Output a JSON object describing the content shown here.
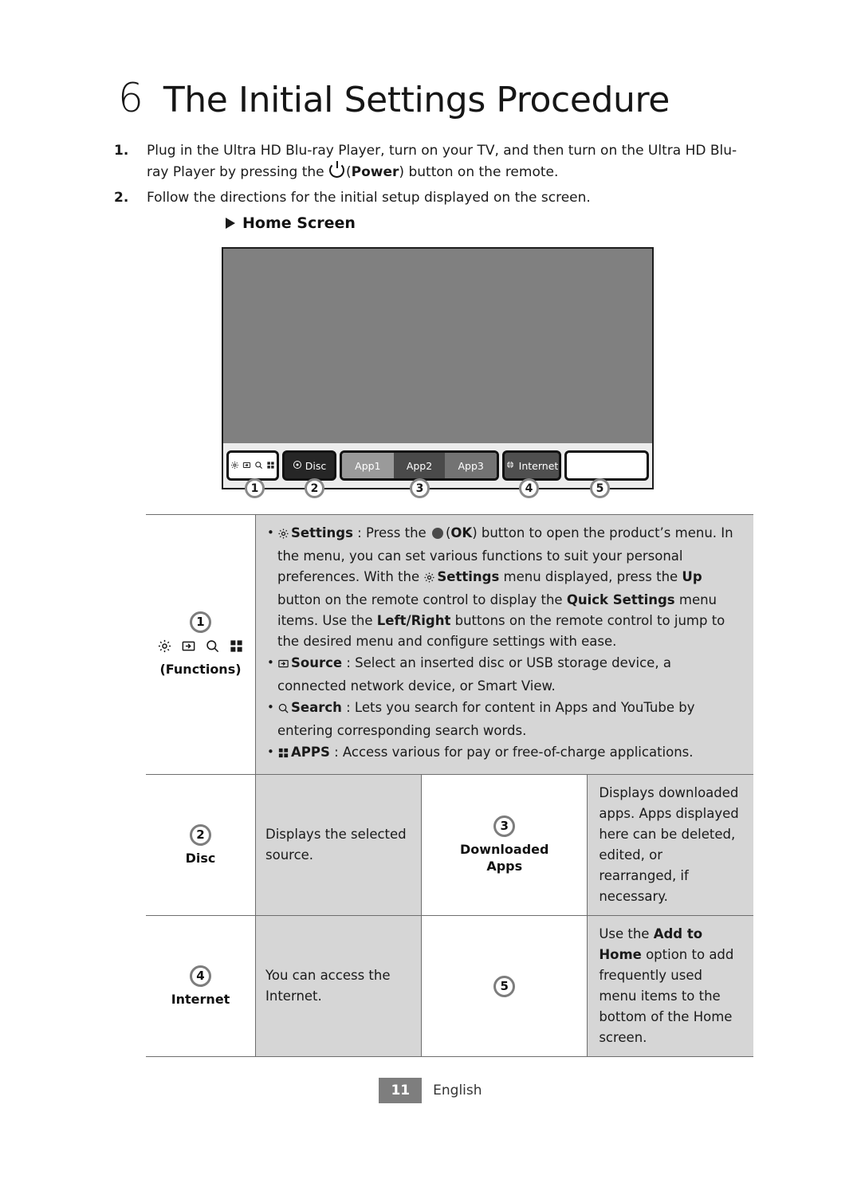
{
  "chapter": {
    "number": "6",
    "title": "The Initial Settings Procedure"
  },
  "steps": [
    {
      "num": "1.",
      "pre": "Plug in the Ultra HD Blu-ray Player, turn on your TV, and then turn on the Ultra HD Blu-ray Player by pressing the ",
      "icon": "power-icon",
      "bold": "Power",
      "post": ") button on the remote.",
      "open": "("
    },
    {
      "num": "2.",
      "text": "Follow the directions for the initial setup displayed on the screen."
    }
  ],
  "sub_heading": "Home Screen",
  "tv": {
    "functions_icons": [
      "gear-icon",
      "source-icon",
      "search-icon",
      "apps-icon"
    ],
    "disc_label": "Disc",
    "apps": [
      "App1",
      "App2",
      "App3"
    ],
    "internet_label": "Internet",
    "callouts": [
      "1",
      "2",
      "3",
      "4",
      "5"
    ]
  },
  "table": {
    "row1": {
      "badge": "1",
      "icons": [
        "gear-icon",
        "source-icon",
        "search-icon",
        "apps-icon"
      ],
      "caption": "(Functions)",
      "bullets": [
        {
          "icon": "gear-icon",
          "name": "Settings",
          "body_1": " : Press the ",
          "ok_open": "(",
          "ok": "OK",
          "body_2": ") button to open the product’s menu. In the menu, you can set various functions to suit your personal preferences. With the ",
          "name_2": "Settings",
          "body_3": " menu displayed, press the ",
          "up": "Up",
          "body_4": " button on the remote control to display the ",
          "quick": "Quick Settings",
          "body_5": " menu items. Use the ",
          "lr": "Left/Right",
          "body_6": " buttons on the remote control to jump to the desired menu and configure settings with ease."
        },
        {
          "icon": "source-icon",
          "name": "Source",
          "body": " : Select an inserted disc or USB storage device, a connected network device, or Smart View."
        },
        {
          "icon": "search-icon",
          "name": "Search",
          "body": " : Lets you search for content in Apps and YouTube by entering corresponding search words."
        },
        {
          "icon": "apps-icon",
          "name": "APPS",
          "body": " : Access various for pay or free-of-charge applications."
        }
      ]
    },
    "row2": {
      "left_badge": "2",
      "left_caption": "Disc",
      "left_desc": "Displays the selected source.",
      "mid_badge": "3",
      "mid_caption_line1": "Downloaded",
      "mid_caption_line2": "Apps",
      "right_desc": "Displays downloaded apps. Apps displayed here can be deleted, edited, or rearranged, if necessary."
    },
    "row3": {
      "left_badge": "4",
      "left_caption": "Internet",
      "left_desc": "You can access the Internet.",
      "mid_badge": "5",
      "right_pre": "Use the ",
      "right_bold": "Add to Home",
      "right_post": " option to add frequently used menu items to the bottom of the Home screen."
    }
  },
  "footer": {
    "page_number": "11",
    "language": "English"
  },
  "colors": {
    "screen_gray": "#808080",
    "strip_gray": "#ececec",
    "cell_gray": "#d6d6d6",
    "badge_ring": "#7d7d7d",
    "page_badge": "#7e7e7e"
  }
}
